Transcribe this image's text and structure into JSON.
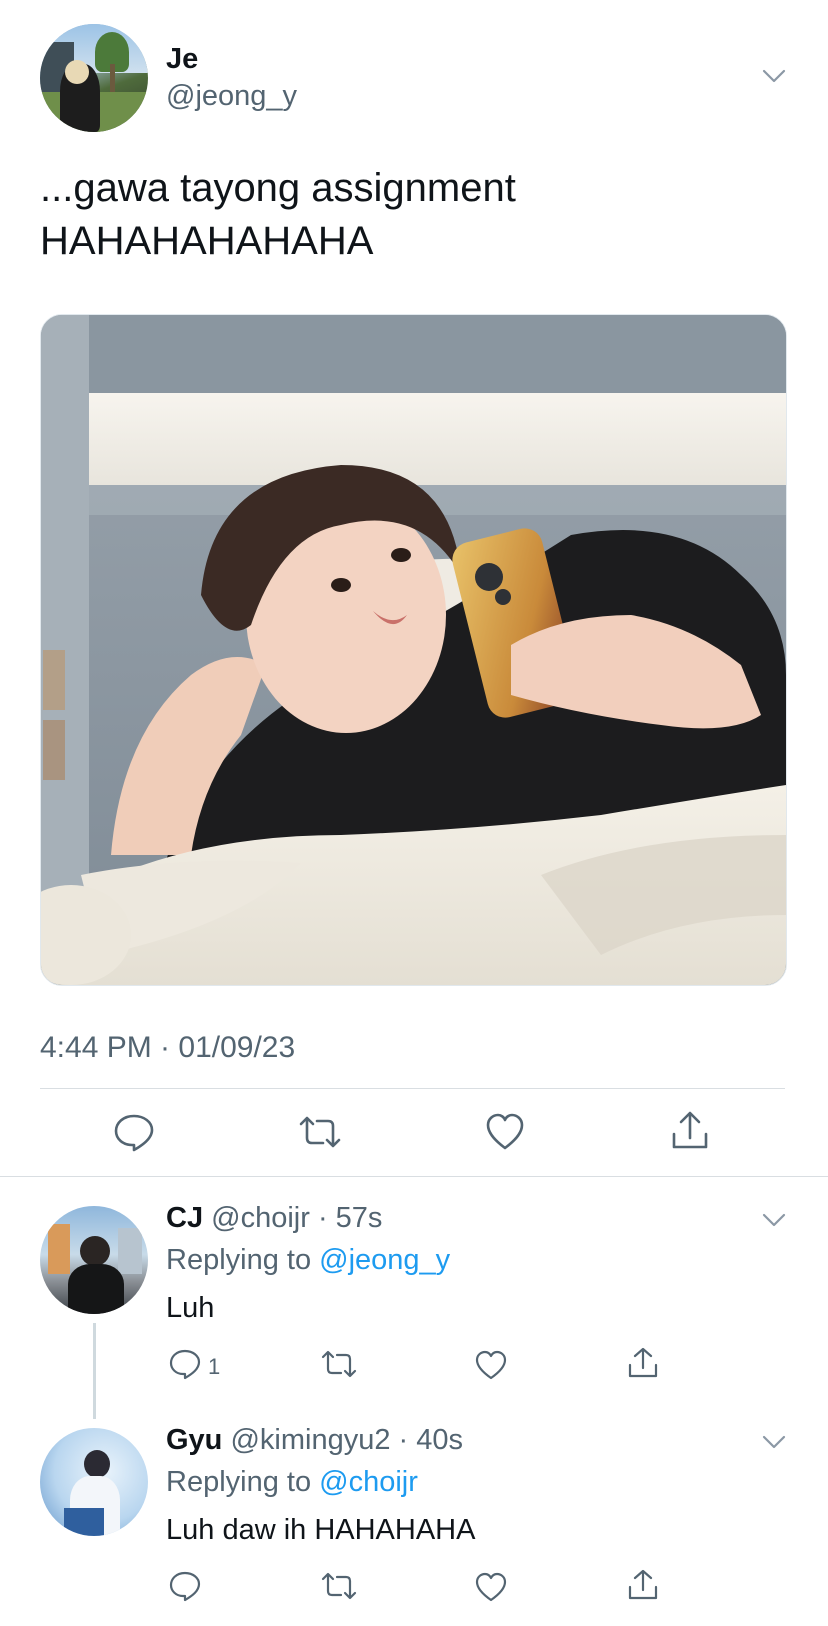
{
  "tweet": {
    "author": {
      "name": "Je",
      "handle": "@jeong_y"
    },
    "text_line1": "...gawa tayong assignment",
    "text_line2": "HAHAHAHAHAHA",
    "timestamp": "4:44 PM · 01/09/23",
    "actions": [
      {
        "icon": "reply-icon"
      },
      {
        "icon": "retweet-icon"
      },
      {
        "icon": "like-icon"
      },
      {
        "icon": "share-icon"
      }
    ]
  },
  "replies": [
    {
      "name": "CJ",
      "handle": "@choijr",
      "time": "57s",
      "replying_label": "Replying to",
      "replying_to": "@jeong_y",
      "text": "Luh",
      "reply_count": "1"
    },
    {
      "name": "Gyu",
      "handle": "@kimingyu2",
      "time": "40s",
      "replying_label": "Replying to",
      "replying_to": "@choijr",
      "text": "Luh daw ih HAHAHAHA",
      "reply_count": ""
    }
  ],
  "colors": {
    "text": "#0f1419",
    "secondary": "#536471",
    "accent": "#1d9bf0",
    "divider": "#d9dee2"
  }
}
